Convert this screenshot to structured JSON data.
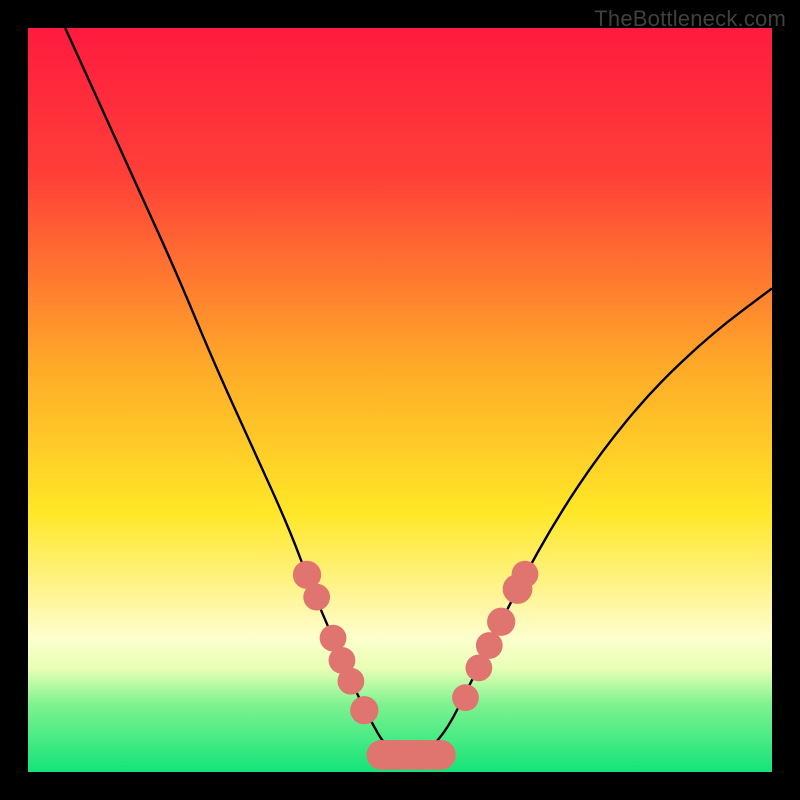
{
  "watermark": "TheBottleneck.com",
  "chart_data": {
    "type": "line",
    "title": "",
    "xlabel": "",
    "ylabel": "",
    "xlim": [
      0,
      100
    ],
    "ylim": [
      0,
      100
    ],
    "gradient_stops": [
      {
        "offset": 0,
        "color": "#ff1a3f"
      },
      {
        "offset": 20,
        "color": "#ff4038"
      },
      {
        "offset": 45,
        "color": "#ffa829"
      },
      {
        "offset": 65,
        "color": "#ffe727"
      },
      {
        "offset": 78,
        "color": "#fff7a8"
      },
      {
        "offset": 82,
        "color": "#fdffcd"
      },
      {
        "offset": 86,
        "color": "#e9ffb6"
      },
      {
        "offset": 91,
        "color": "#7df28f"
      },
      {
        "offset": 100,
        "color": "#14e37a"
      }
    ],
    "series": [
      {
        "name": "bottleneck-curve",
        "x": [
          5,
          10,
          15,
          20,
          25,
          30,
          35,
          38,
          41,
          43.5,
          46,
          48,
          50,
          52,
          54,
          56.5,
          59,
          62,
          66,
          71,
          77,
          84,
          92,
          100
        ],
        "y": [
          100,
          89,
          78,
          67,
          55,
          44,
          33,
          25,
          18,
          12,
          7,
          3.5,
          2.2,
          2.2,
          3.0,
          6,
          11,
          17,
          25,
          34,
          43,
          51.5,
          59,
          65
        ]
      }
    ],
    "markers": {
      "name": "highlight-dots",
      "color": "#e0746e",
      "points": [
        {
          "x": 37.5,
          "y": 26.5,
          "r": 1.9
        },
        {
          "x": 38.8,
          "y": 23.5,
          "r": 1.8
        },
        {
          "x": 41.0,
          "y": 18.0,
          "r": 1.8
        },
        {
          "x": 42.2,
          "y": 15.0,
          "r": 1.8
        },
        {
          "x": 43.4,
          "y": 12.2,
          "r": 1.8
        },
        {
          "x": 45.2,
          "y": 8.3,
          "r": 1.9
        },
        {
          "x": 58.8,
          "y": 10.0,
          "r": 1.8
        },
        {
          "x": 60.6,
          "y": 14.0,
          "r": 1.8
        },
        {
          "x": 62.0,
          "y": 17.0,
          "r": 1.8
        },
        {
          "x": 63.6,
          "y": 20.2,
          "r": 1.9
        },
        {
          "x": 65.8,
          "y": 24.6,
          "r": 2.0
        },
        {
          "x": 66.8,
          "y": 26.6,
          "r": 1.8
        }
      ],
      "flat_segment": {
        "x1": 47.5,
        "x2": 55.5,
        "y": 2.3,
        "r": 2.0
      }
    }
  }
}
